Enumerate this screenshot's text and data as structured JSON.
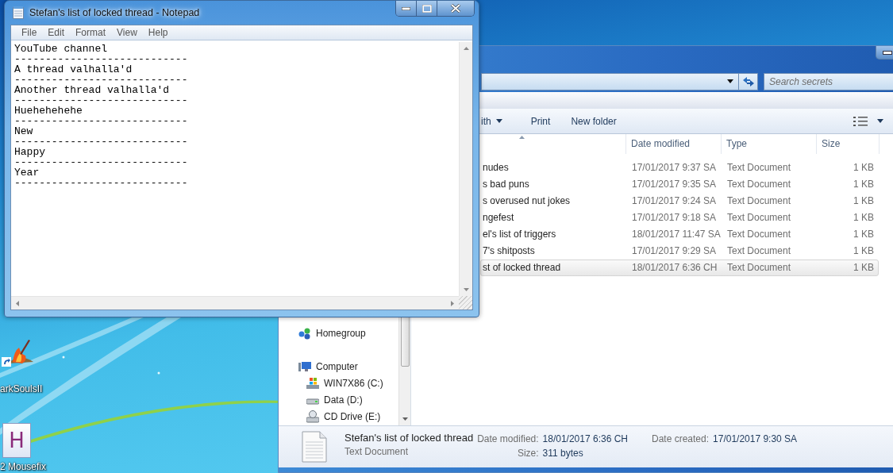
{
  "desktop": {
    "icons": [
      {
        "kind": "shortcut",
        "label": "arkSoulsII"
      },
      {
        "kind": "document",
        "glyph": "H",
        "label": "2 Mousefix"
      }
    ]
  },
  "explorer": {
    "search": {
      "placeholder": "Search secrets"
    },
    "toolbar": [
      {
        "label": "ith",
        "dropdown": true
      },
      {
        "label": "Print",
        "dropdown": false
      },
      {
        "label": "New folder",
        "dropdown": false
      }
    ],
    "columns": [
      "Date modified",
      "Type",
      "Size"
    ],
    "files": [
      {
        "name": "nudes",
        "date_modified": "17/01/2017 9:37 SA",
        "type": "Text Document",
        "size": "1 KB",
        "selected": false
      },
      {
        "name": "s bad puns",
        "date_modified": "17/01/2017 9:35 SA",
        "type": "Text Document",
        "size": "1 KB",
        "selected": false
      },
      {
        "name": "s overused nut jokes",
        "date_modified": "17/01/2017 9:24 SA",
        "type": "Text Document",
        "size": "1 KB",
        "selected": false
      },
      {
        "name": "ngefest",
        "date_modified": "17/01/2017 9:18 SA",
        "type": "Text Document",
        "size": "1 KB",
        "selected": false
      },
      {
        "name": "el's list of triggers",
        "date_modified": "18/01/2017 11:47 SA",
        "type": "Text Document",
        "size": "1 KB",
        "selected": false
      },
      {
        "name": "7's shitposts",
        "date_modified": "17/01/2017 9:29 SA",
        "type": "Text Document",
        "size": "1 KB",
        "selected": false
      },
      {
        "name": "st of locked thread",
        "date_modified": "18/01/2017 6:36 CH",
        "type": "Text Document",
        "size": "1 KB",
        "selected": true
      }
    ],
    "nav": [
      {
        "kind": "homegroup",
        "label": "Homegroup"
      },
      {
        "kind": "computer",
        "label": "Computer",
        "children": [
          {
            "kind": "system-drive",
            "label": "WIN7X86 (C:)"
          },
          {
            "kind": "drive",
            "label": "Data (D:)"
          },
          {
            "kind": "cd-drive",
            "label": "CD Drive (E:)"
          }
        ]
      }
    ],
    "details": {
      "name": "Stefan's list of locked thread",
      "type": "Text Document",
      "field_columns": [
        [
          {
            "label": "Date modified:",
            "value": "18/01/2017 6:36 CH"
          },
          {
            "label": "Size:",
            "value": "311 bytes"
          }
        ],
        [
          {
            "label": "Date created:",
            "value": "17/01/2017 9:30 SA"
          }
        ]
      ]
    }
  },
  "notepad": {
    "title": "Stefan's list of locked thread - Notepad",
    "menu": [
      "File",
      "Edit",
      "Format",
      "View",
      "Help"
    ],
    "lines": [
      "YouTube channel",
      "----------------------------",
      "A thread valhalla'd",
      "----------------------------",
      "Another thread valhalla'd",
      "----------------------------",
      "Huehehehehe",
      "----------------------------",
      "New",
      "----------------------------",
      "Happy",
      "----------------------------",
      "Year",
      "----------------------------"
    ]
  }
}
